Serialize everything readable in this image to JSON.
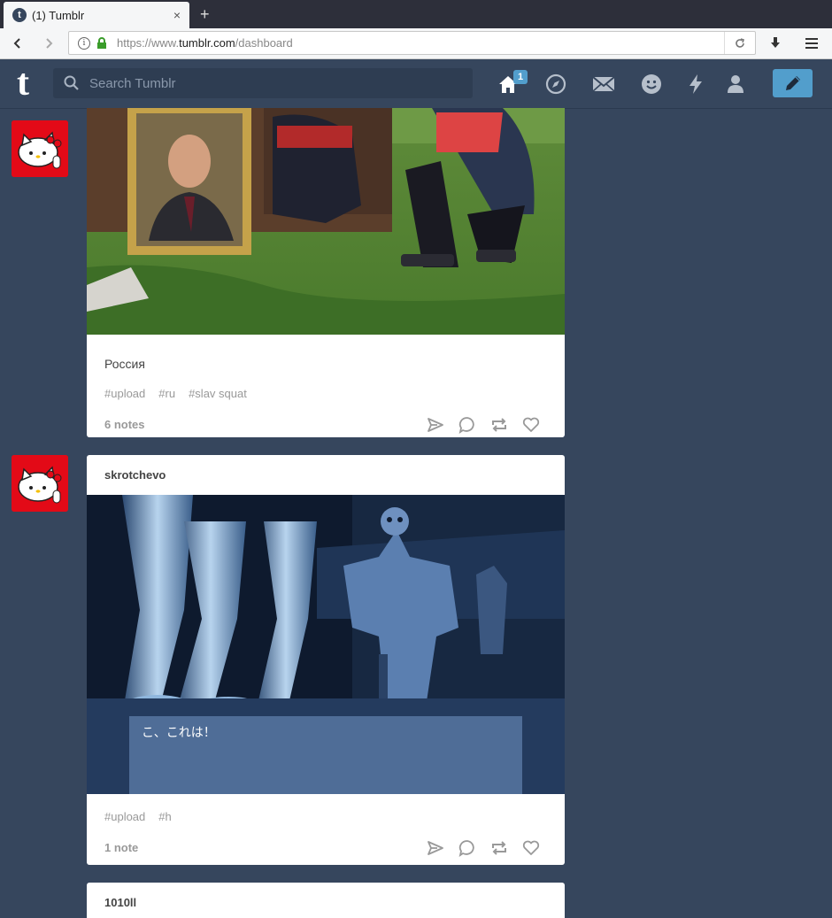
{
  "browser": {
    "tab_title": "(1) Tumblr",
    "favicon_letter": "t",
    "tab_close": "×",
    "new_tab": "+",
    "url_prefix": "https://www.",
    "url_domain": "tumblr.com",
    "url_path": "/dashboard"
  },
  "header": {
    "logo": "t",
    "search_placeholder": "Search Tumblr",
    "home_badge": "1",
    "icons": [
      "home-icon",
      "explore-icon",
      "inbox-icon",
      "messaging-icon",
      "activity-icon",
      "account-icon",
      "compose-icon"
    ]
  },
  "posts": [
    {
      "caption": "Россия",
      "tags": [
        "#upload",
        "#ru",
        "#slav squat"
      ],
      "notes": "6 notes"
    },
    {
      "author": "skrotchevo",
      "image_text": "こ、これは！",
      "tags": [
        "#upload",
        "#h"
      ],
      "notes": "1 note"
    },
    {
      "author": "1010ll"
    }
  ],
  "colors": {
    "dashboard_bg": "#36465d",
    "accent": "#529ecc",
    "avatar_bg": "#e30a17"
  }
}
